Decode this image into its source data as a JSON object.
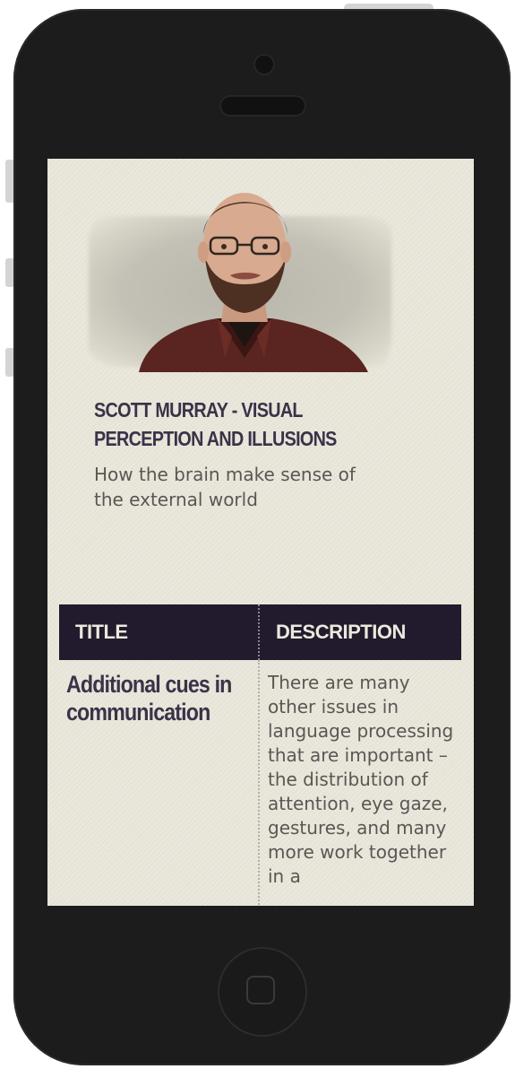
{
  "talk": {
    "title": "SCOTT MURRAY - VISUAL PERCEPTION AND ILLUSIONS",
    "subtitle": "How the brain make sense of the external world"
  },
  "table": {
    "headers": {
      "title": "TITLE",
      "description": "DESCRIPTION"
    },
    "rows": [
      {
        "title": "Additional cues in communication",
        "description": "There are many other issues in language processing that are important – the distribution of attention, eye gaze, gestures, and many more work together in a"
      }
    ]
  },
  "colors": {
    "page_background": "#e8e5d9",
    "header_background": "#221a2d",
    "heading_text": "#3a3348",
    "body_text": "#5b5654",
    "phone_body": "#1c1c1c"
  },
  "icons": {
    "home_button": "home-button-square-icon"
  }
}
